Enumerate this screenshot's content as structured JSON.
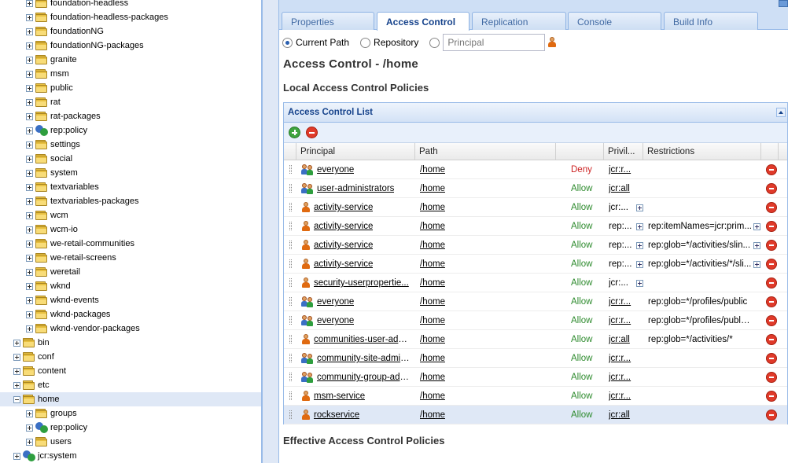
{
  "tree": {
    "items": [
      {
        "label": "foundation-headless",
        "level": 2,
        "type": "folder"
      },
      {
        "label": "foundation-headless-packages",
        "level": 2,
        "type": "folder"
      },
      {
        "label": "foundationNG",
        "level": 2,
        "type": "folder"
      },
      {
        "label": "foundationNG-packages",
        "level": 2,
        "type": "folder"
      },
      {
        "label": "granite",
        "level": 2,
        "type": "folder"
      },
      {
        "label": "msm",
        "level": 2,
        "type": "folder"
      },
      {
        "label": "public",
        "level": 2,
        "type": "folder"
      },
      {
        "label": "rat",
        "level": 2,
        "type": "folder"
      },
      {
        "label": "rat-packages",
        "level": 2,
        "type": "folder"
      },
      {
        "label": "rep:policy",
        "level": 2,
        "type": "policy"
      },
      {
        "label": "settings",
        "level": 2,
        "type": "folder"
      },
      {
        "label": "social",
        "level": 2,
        "type": "folder"
      },
      {
        "label": "system",
        "level": 2,
        "type": "folder"
      },
      {
        "label": "textvariables",
        "level": 2,
        "type": "folder"
      },
      {
        "label": "textvariables-packages",
        "level": 2,
        "type": "folder"
      },
      {
        "label": "wcm",
        "level": 2,
        "type": "folder"
      },
      {
        "label": "wcm-io",
        "level": 2,
        "type": "folder"
      },
      {
        "label": "we-retail-communities",
        "level": 2,
        "type": "folder"
      },
      {
        "label": "we-retail-screens",
        "level": 2,
        "type": "folder"
      },
      {
        "label": "weretail",
        "level": 2,
        "type": "folder"
      },
      {
        "label": "wknd",
        "level": 2,
        "type": "folder"
      },
      {
        "label": "wknd-events",
        "level": 2,
        "type": "folder"
      },
      {
        "label": "wknd-packages",
        "level": 2,
        "type": "folder"
      },
      {
        "label": "wknd-vendor-packages",
        "level": 2,
        "type": "folder"
      },
      {
        "label": "bin",
        "level": 1,
        "type": "folder"
      },
      {
        "label": "conf",
        "level": 1,
        "type": "folder"
      },
      {
        "label": "content",
        "level": 1,
        "type": "folder"
      },
      {
        "label": "etc",
        "level": 1,
        "type": "folder"
      },
      {
        "label": "home",
        "level": 1,
        "type": "folder",
        "expanded": true,
        "selected": true
      },
      {
        "label": "groups",
        "level": 2,
        "type": "folder"
      },
      {
        "label": "rep:policy",
        "level": 2,
        "type": "policy"
      },
      {
        "label": "users",
        "level": 2,
        "type": "folder"
      },
      {
        "label": "jcr:system",
        "level": 1,
        "type": "policy"
      }
    ]
  },
  "tabs": [
    {
      "label": "Properties",
      "active": false
    },
    {
      "label": "Access Control",
      "active": true
    },
    {
      "label": "Replication",
      "active": false
    },
    {
      "label": "Console",
      "active": false
    },
    {
      "label": "Build Info",
      "active": false
    }
  ],
  "scope": {
    "current_path_label": "Current Path",
    "repository_label": "Repository",
    "principal_placeholder": "Principal",
    "selected": "current_path"
  },
  "page_title": "Access Control - /home",
  "local_title": "Local Access Control Policies",
  "effective_title": "Effective Access Control Policies",
  "acl": {
    "title": "Access Control List",
    "columns": {
      "principal": "Principal",
      "path": "Path",
      "privileges": "Privil...",
      "restrictions": "Restrictions"
    },
    "rows": [
      {
        "principal": "everyone",
        "kind": "group",
        "path": "/home",
        "permission": "Deny",
        "privileges": "jcr:r...",
        "priv_expand": false,
        "restrictions": "",
        "restr_expand": false
      },
      {
        "principal": "user-administrators",
        "kind": "group",
        "path": "/home",
        "permission": "Allow",
        "privileges": "jcr:all",
        "priv_expand": false,
        "restrictions": "",
        "restr_expand": false
      },
      {
        "principal": "activity-service",
        "kind": "user",
        "path": "/home",
        "permission": "Allow",
        "privileges": "jcr:...",
        "priv_expand": true,
        "restrictions": "",
        "restr_expand": false
      },
      {
        "principal": "activity-service",
        "kind": "user",
        "path": "/home",
        "permission": "Allow",
        "privileges": "rep:...",
        "priv_expand": true,
        "restrictions": "rep:itemNames=jcr:prim...",
        "restr_expand": true
      },
      {
        "principal": "activity-service",
        "kind": "user",
        "path": "/home",
        "permission": "Allow",
        "privileges": "rep:...",
        "priv_expand": true,
        "restrictions": "rep:glob=*/activities/slin...",
        "restr_expand": true
      },
      {
        "principal": "activity-service",
        "kind": "user",
        "path": "/home",
        "permission": "Allow",
        "privileges": "rep:...",
        "priv_expand": true,
        "restrictions": "rep:glob=*/activities/*/sli...",
        "restr_expand": true
      },
      {
        "principal": "security-userpropertie...",
        "kind": "user",
        "path": "/home",
        "permission": "Allow",
        "privileges": "jcr:...",
        "priv_expand": true,
        "restrictions": "",
        "restr_expand": false
      },
      {
        "principal": "everyone",
        "kind": "group",
        "path": "/home",
        "permission": "Allow",
        "privileges": "jcr:r...",
        "priv_expand": false,
        "restrictions": "rep:glob=*/profiles/public",
        "restr_expand": false
      },
      {
        "principal": "everyone",
        "kind": "group",
        "path": "/home",
        "permission": "Allow",
        "privileges": "jcr:r...",
        "priv_expand": false,
        "restrictions": "rep:glob=*/profiles/public/*",
        "restr_expand": false
      },
      {
        "principal": "communities-user-admin",
        "kind": "user",
        "path": "/home",
        "permission": "Allow",
        "privileges": "jcr:all",
        "priv_expand": false,
        "restrictions": "rep:glob=*/activities/*",
        "restr_expand": false
      },
      {
        "principal": "community-site-admini...",
        "kind": "group",
        "path": "/home",
        "permission": "Allow",
        "privileges": "jcr:r...",
        "priv_expand": false,
        "restrictions": "",
        "restr_expand": false
      },
      {
        "principal": "community-group-adm...",
        "kind": "group",
        "path": "/home",
        "permission": "Allow",
        "privileges": "jcr:r...",
        "priv_expand": false,
        "restrictions": "",
        "restr_expand": false
      },
      {
        "principal": "msm-service",
        "kind": "user",
        "path": "/home",
        "permission": "Allow",
        "privileges": "jcr:r...",
        "priv_expand": false,
        "restrictions": "",
        "restr_expand": false
      },
      {
        "principal": "rockservice",
        "kind": "user",
        "path": "/home",
        "permission": "Allow",
        "privileges": "jcr:all",
        "priv_expand": false,
        "restrictions": "",
        "restr_expand": false,
        "selected": true
      }
    ]
  },
  "colors": {
    "allow": "#2e8b2e",
    "deny": "#cc2020",
    "header_text": "#15428b",
    "selection": "#dfe8f6"
  }
}
